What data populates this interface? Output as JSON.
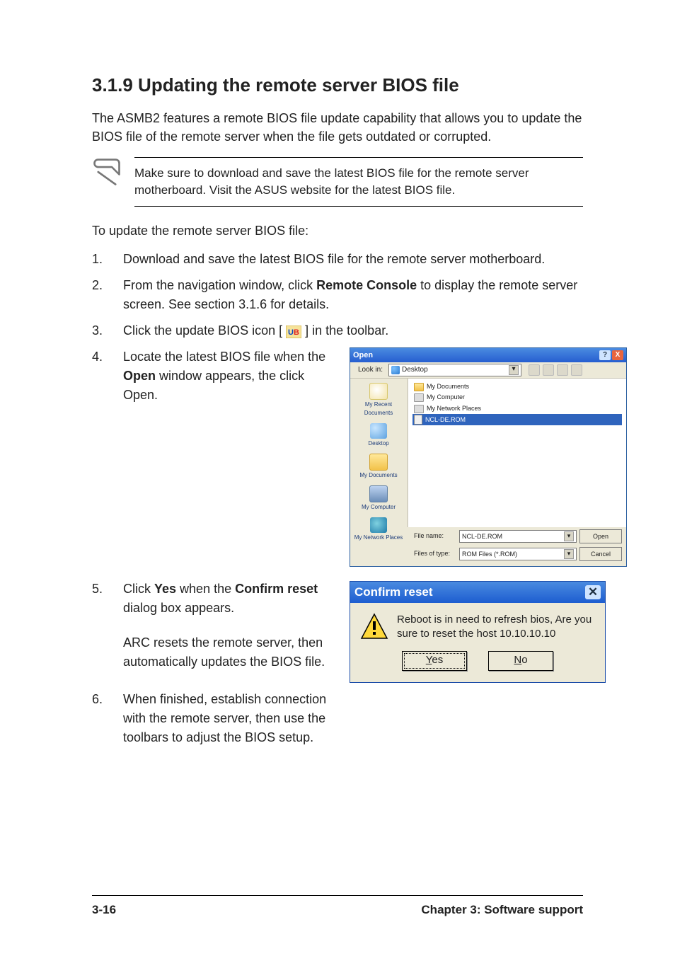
{
  "heading": "3.1.9   Updating the remote server BIOS file",
  "intro": "The ASMB2 features a remote BIOS file update capability that allows you to update the BIOS file of the remote server when the file gets outdated or corrupted.",
  "note": "Make sure to download and save the latest BIOS file for the remote server motherboard. Visit the ASUS website for the latest BIOS file.",
  "lead_in": "To update the remote server BIOS file:",
  "steps": {
    "1": "Download and save the latest BIOS file for the remote server motherboard.",
    "2a": "From the navigation window, click ",
    "2b": "Remote Console",
    "2c": " to display the remote server screen. See section 3.1.6 for details.",
    "3a": "Click the update BIOS icon [ ",
    "3b": " ] in the toolbar.",
    "4a": "Locate the latest BIOS file when the ",
    "4b": "Open",
    "4c": " window appears, the click Open.",
    "5a": "Click ",
    "5b": "Yes",
    "5c": " when the ",
    "5d": "Confirm reset",
    "5e": " dialog box appears.",
    "5f": "ARC resets the remote server, then automatically updates the BIOS file.",
    "6": "When finished, establish connection with the remote server, then use the toolbars to adjust the BIOS setup."
  },
  "open_dialog": {
    "title": "Open",
    "look_in_label": "Look in:",
    "look_in_value": "Desktop",
    "places": [
      "My Recent Documents",
      "Desktop",
      "My Documents",
      "My Computer",
      "My Network Places"
    ],
    "files": [
      "My Documents",
      "My Computer",
      "My Network Places",
      "NCL-DE.ROM"
    ],
    "file_name_label": "File name:",
    "file_name_value": "NCL-DE.ROM",
    "file_type_label": "Files of type:",
    "file_type_value": "ROM Files (*.ROM)",
    "open_btn": "Open",
    "cancel_btn": "Cancel"
  },
  "confirm_dialog": {
    "title": "Confirm reset",
    "msg": "Reboot is in need to refresh bios, Are you sure to reset the host 10.10.10.10",
    "yes": "Yes",
    "no": "No"
  },
  "footer": {
    "page": "3-16",
    "chapter": "Chapter 3: Software support"
  }
}
